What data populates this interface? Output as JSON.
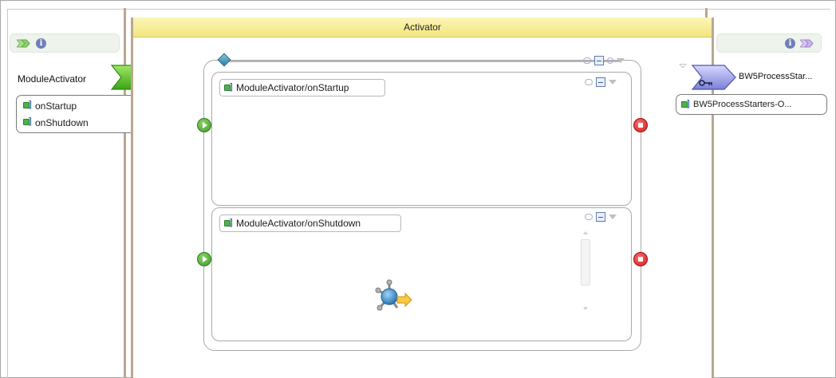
{
  "activator": {
    "title": "Activator"
  },
  "left_component": {
    "name": "ModuleActivator",
    "operations": [
      {
        "label": "onStartup"
      },
      {
        "label": "onShutdown"
      }
    ],
    "info_glyph": "i"
  },
  "right_component": {
    "name": "BW5ProcessStar...",
    "operations": [
      {
        "label": "BW5ProcessStarters-O..."
      }
    ],
    "info_glyph": "i"
  },
  "scopes": [
    {
      "title": "ModuleActivator/onStartup"
    },
    {
      "title": "ModuleActivator/onShutdown"
    }
  ],
  "icons": {
    "service_arrow": "chevron-arrow-icon",
    "reference": "reference-key-icon",
    "info": "info-icon",
    "start": "start-event-icon",
    "end": "end-event-icon",
    "activity": "activity-gear-icon"
  },
  "colors": {
    "header_yellow": "#f3e67e",
    "lane_border": "#b8a890",
    "service_green": "#4fbf1f",
    "reference_purple": "#8c8fd6",
    "start_green": "#3f9a2a",
    "end_red": "#d11f1f"
  }
}
